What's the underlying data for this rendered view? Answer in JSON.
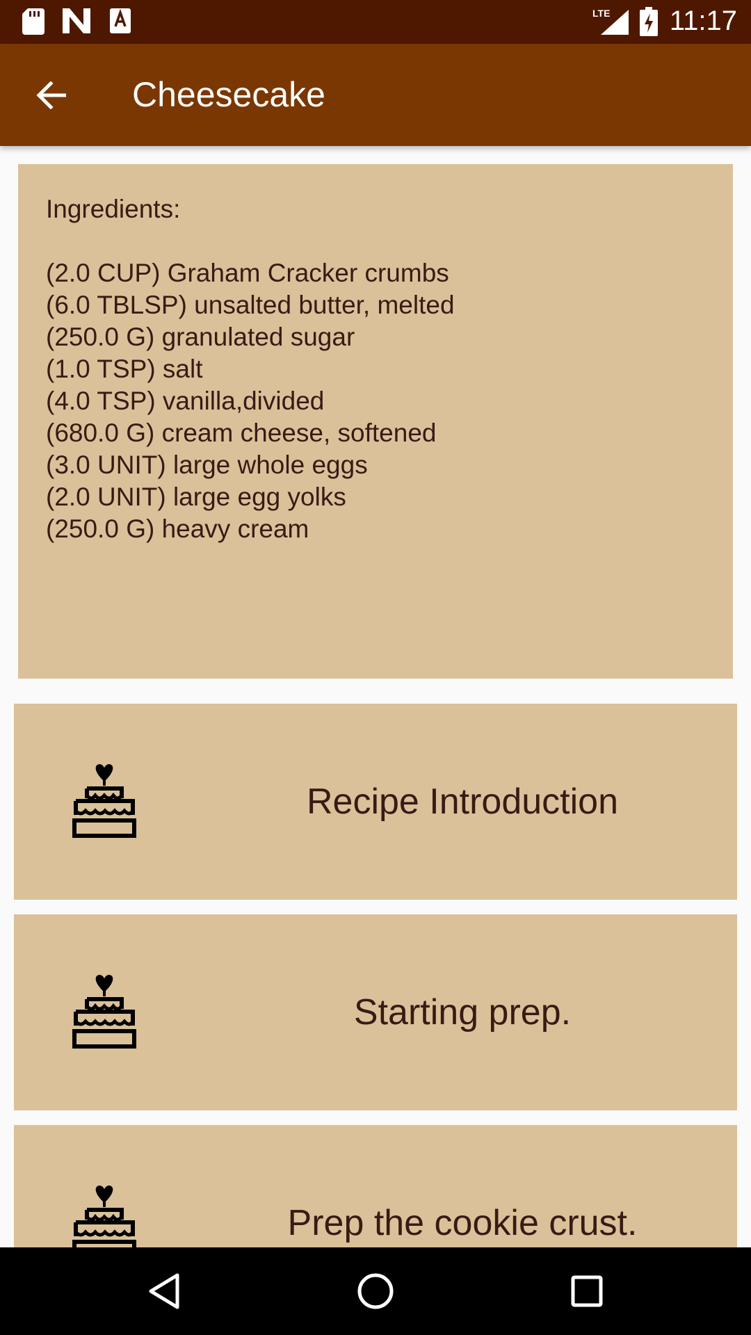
{
  "status_bar": {
    "time": "11:17",
    "network": "LTE",
    "icons": [
      "sd-card-icon",
      "n-notification-icon",
      "a-notification-icon",
      "lte-signal-icon",
      "battery-charging-icon"
    ]
  },
  "app_bar": {
    "title": "Cheesecake",
    "back_icon": "arrow-back-icon"
  },
  "ingredients": {
    "heading": "Ingredients:",
    "items": [
      "(2.0 CUP) Graham Cracker crumbs",
      "(6.0 TBLSP) unsalted butter, melted",
      "(250.0 G) granulated sugar",
      "(1.0 TSP) salt",
      "(4.0 TSP) vanilla,divided",
      "(680.0 G) cream cheese, softened",
      "(3.0 UNIT) large whole eggs",
      "(2.0 UNIT) large egg yolks",
      "(250.0 G) heavy cream"
    ]
  },
  "steps": [
    {
      "label": "Recipe Introduction",
      "icon": "cake-icon"
    },
    {
      "label": "Starting prep.",
      "icon": "cake-icon"
    },
    {
      "label": "Prep the cookie crust.",
      "icon": "cake-icon"
    }
  ],
  "nav_bar": {
    "buttons": [
      "back-triangle-icon",
      "home-circle-icon",
      "recents-square-icon"
    ]
  },
  "colors": {
    "status_bar": "#4e1800",
    "app_bar": "#7a3701",
    "card": "#dac199",
    "card_text": "#3a1a14",
    "background": "#fafafa"
  }
}
